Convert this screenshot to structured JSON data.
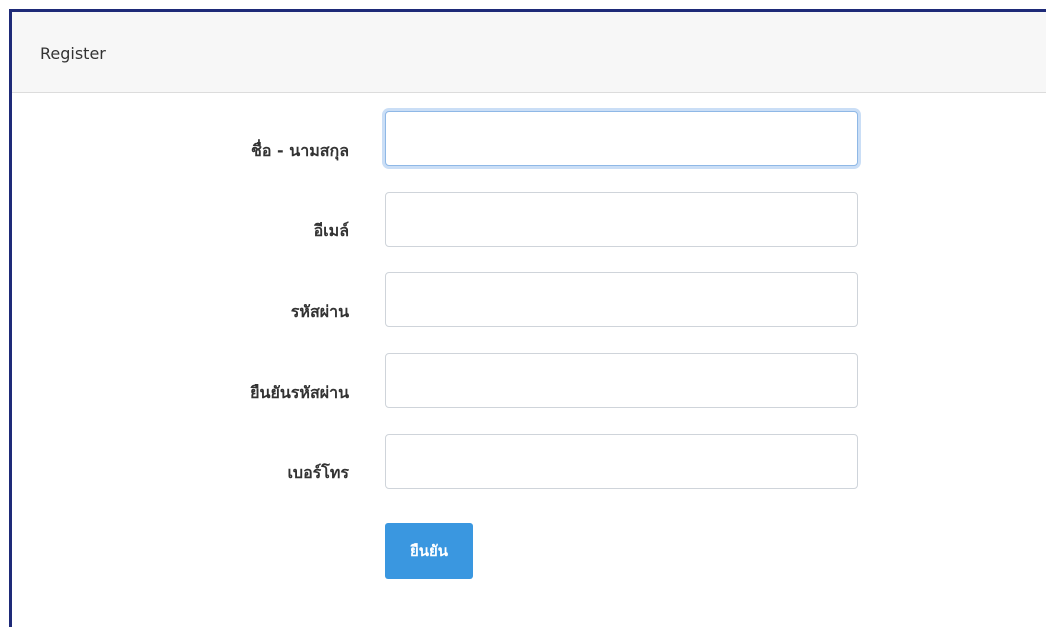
{
  "card": {
    "title": "Register"
  },
  "form": {
    "fields": [
      {
        "label": "ชื่อ - นามสกุล",
        "value": "",
        "placeholder": ""
      },
      {
        "label": "อีเมล์",
        "value": "",
        "placeholder": ""
      },
      {
        "label": "รหัสผ่าน",
        "value": "",
        "placeholder": ""
      },
      {
        "label": "ยืนยันรหัสผ่าน",
        "value": "",
        "placeholder": ""
      },
      {
        "label": "เบอร์โทร",
        "value": "",
        "placeholder": ""
      }
    ],
    "submit_label": "ยืนยัน"
  },
  "colors": {
    "accent": "#3a97e0",
    "frame_border": "#1e2a78",
    "header_bg": "#f7f7f7"
  }
}
